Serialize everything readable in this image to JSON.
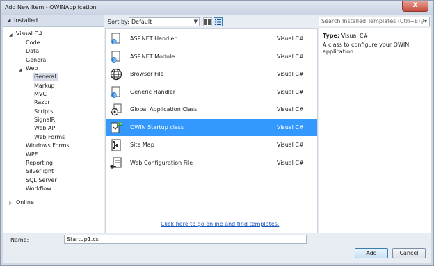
{
  "window": {
    "title": "Add New Item - OWINApplication",
    "close_glyph": "X"
  },
  "tree": {
    "header": "Installed",
    "nodes": [
      {
        "label": "Visual C#"
      },
      {
        "label": "Code"
      },
      {
        "label": "Data"
      },
      {
        "label": "General"
      },
      {
        "label": "Web"
      },
      {
        "label": "General"
      },
      {
        "label": "Markup"
      },
      {
        "label": "MVC"
      },
      {
        "label": "Razor"
      },
      {
        "label": "Scripts"
      },
      {
        "label": "SignalR"
      },
      {
        "label": "Web API"
      },
      {
        "label": "Web Forms"
      },
      {
        "label": "Windows Forms"
      },
      {
        "label": "WPF"
      },
      {
        "label": "Reporting"
      },
      {
        "label": "Silverlight"
      },
      {
        "label": "SQL Server"
      },
      {
        "label": "Workflow"
      }
    ],
    "online": "Online"
  },
  "sort": {
    "label": "Sort by:",
    "value": "Default"
  },
  "items": [
    {
      "name": "ASP.NET Handler",
      "lang": "Visual C#",
      "icon": "aspnet-handler-icon"
    },
    {
      "name": "ASP.NET Module",
      "lang": "Visual C#",
      "icon": "aspnet-module-icon"
    },
    {
      "name": "Browser File",
      "lang": "Visual C#",
      "icon": "globe-icon"
    },
    {
      "name": "Generic Handler",
      "lang": "Visual C#",
      "icon": "generic-handler-icon"
    },
    {
      "name": "Global Application Class",
      "lang": "Visual C#",
      "icon": "gear-icon"
    },
    {
      "name": "OWIN Startup class",
      "lang": "Visual C#",
      "icon": "owin-startup-icon"
    },
    {
      "name": "Site Map",
      "lang": "Visual C#",
      "icon": "sitemap-icon"
    },
    {
      "name": "Web Configuration File",
      "lang": "Visual C#",
      "icon": "web-config-icon"
    }
  ],
  "online_link": "Click here to go online and find templates.",
  "search": {
    "placeholder": "Search Installed Templates (Ctrl+E)"
  },
  "detail": {
    "type_label": "Type:",
    "type_value": "Visual C#",
    "description": "A class to configure your OWIN application"
  },
  "name_field": {
    "label": "Name:",
    "value": "Startup1.cs"
  },
  "buttons": {
    "add": "Add",
    "cancel": "Cancel"
  },
  "colors": {
    "selection": "#3399ff",
    "link": "#1c57c0"
  }
}
